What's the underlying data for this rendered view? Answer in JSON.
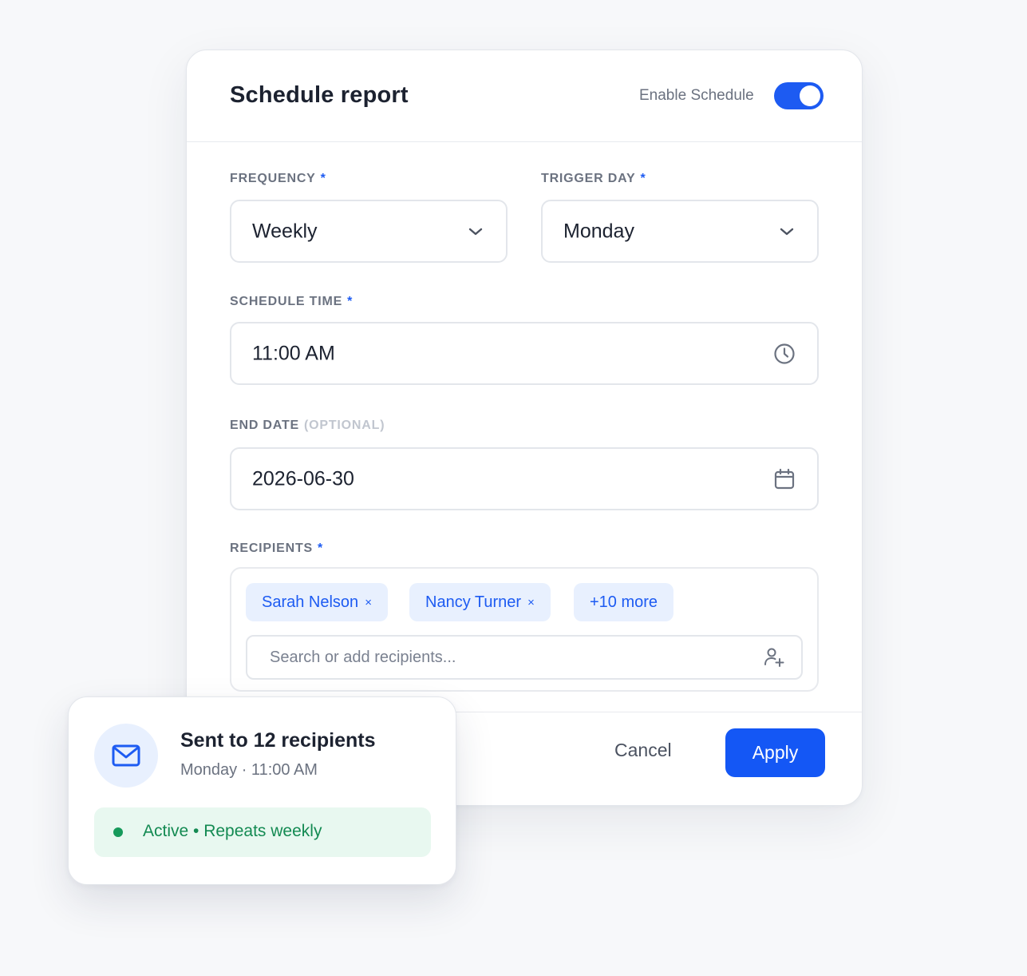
{
  "modal": {
    "title": "Schedule report",
    "enable_label": "Enable Schedule",
    "enable_on": true
  },
  "frequency": {
    "label": "FREQUENCY",
    "required": "*",
    "value": "Weekly"
  },
  "trigger_day": {
    "label": "TRIGGER DAY",
    "required": "*",
    "value": "Monday"
  },
  "schedule_time": {
    "label": "SCHEDULE TIME",
    "required": "*",
    "value": "11:00 AM"
  },
  "end_date": {
    "label": "END DATE",
    "optional": "(OPTIONAL)",
    "value": "2026-06-30"
  },
  "recipients": {
    "label": "RECIPIENTS",
    "required": "*",
    "chips": [
      {
        "name": "Sarah Nelson",
        "remove": "×"
      },
      {
        "name": "Nancy Turner",
        "remove": "×"
      }
    ],
    "more": "+10 more",
    "search_placeholder": "Search or add recipients..."
  },
  "footer": {
    "cancel": "Cancel",
    "apply": "Apply"
  },
  "notification": {
    "title": "Sent to 12 recipients",
    "subtitle": "Monday · 11:00 AM",
    "status": "Active • Repeats weekly"
  },
  "colors": {
    "accent": "#1d5bf2",
    "success": "#169a5b"
  }
}
